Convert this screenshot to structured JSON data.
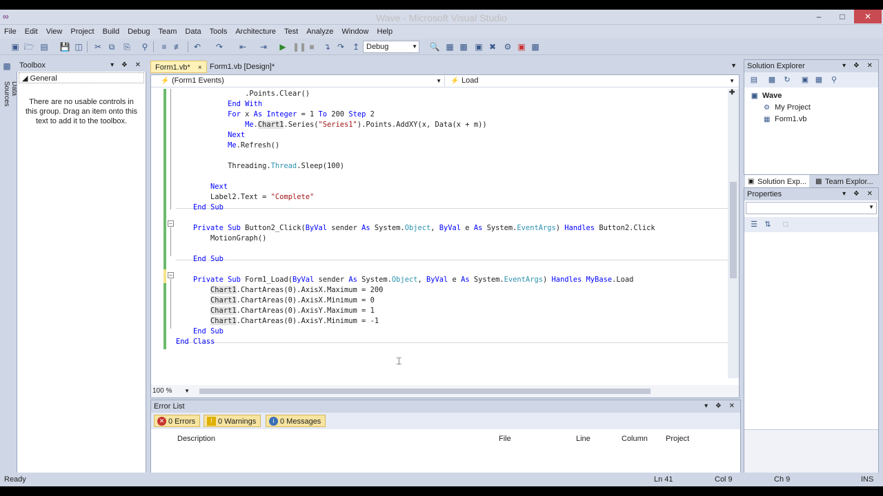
{
  "window": {
    "title": "Wave - Microsoft Visual Studio",
    "minimize": "–",
    "maximize": "□",
    "close": "✕"
  },
  "menu": [
    "File",
    "Edit",
    "View",
    "Project",
    "Build",
    "Debug",
    "Team",
    "Data",
    "Tools",
    "Architecture",
    "Test",
    "Analyze",
    "Window",
    "Help"
  ],
  "toolbar": {
    "config": "Debug"
  },
  "side_tab": {
    "label": "Data Sources"
  },
  "toolbox": {
    "title": "Toolbox",
    "group": "General",
    "message": "There are no usable controls in this group. Drag an item onto this text to add it to the toolbox."
  },
  "tabs": [
    {
      "label": "Form1.vb*",
      "close": "×"
    },
    {
      "label": "Form1.vb [Design]*"
    }
  ],
  "editor": {
    "nav_left": "(Form1 Events)",
    "nav_right": "Load",
    "zoom": "100 %"
  },
  "code": [
    "                .Points.Clear()",
    "            End With",
    "            For x As Integer = 1 To 200 Step 2",
    "                Me.Chart1.Series(\"Series1\").Points.AddXY(x, Data(x + m))",
    "            Next",
    "            Me.Refresh()",
    "",
    "            Threading.Thread.Sleep(100)",
    "",
    "        Next",
    "        Label2.Text = \"Complete\"",
    "    End Sub",
    "",
    "    Private Sub Button2_Click(ByVal sender As System.Object, ByVal e As System.EventArgs) Handles Button2.Click",
    "        MotionGraph()",
    "",
    "    End Sub",
    "",
    "    Private Sub Form1_Load(ByVal sender As System.Object, ByVal e As System.EventArgs) Handles MyBase.Load",
    "        Chart1.ChartAreas(0).AxisX.Maximum = 200",
    "        Chart1.ChartAreas(0).AxisX.Minimum = 0",
    "        Chart1.ChartAreas(0).AxisY.Maximum = 1",
    "        Chart1.ChartAreas(0).AxisY.Minimum = -1",
    "    End Sub",
    "End Class"
  ],
  "error_list": {
    "title": "Error List",
    "errors": "0 Errors",
    "warnings": "0 Warnings",
    "messages": "0 Messages",
    "columns": [
      "Description",
      "File",
      "Line",
      "Column",
      "Project"
    ]
  },
  "solution_explorer": {
    "title": "Solution Explorer",
    "items": [
      "Wave",
      "My Project",
      "Form1.vb"
    ],
    "tab1": "Solution Exp...",
    "tab2": "Team Explor..."
  },
  "properties": {
    "title": "Properties"
  },
  "status": {
    "text": "Ready",
    "line": "Ln 41",
    "col": "Col 9",
    "ch": "Ch 9",
    "mode": "INS"
  },
  "colors": {
    "keyword": "#0000ff",
    "type": "#2b91af",
    "string": "#a31515",
    "chrome": "#cfd6e5"
  }
}
